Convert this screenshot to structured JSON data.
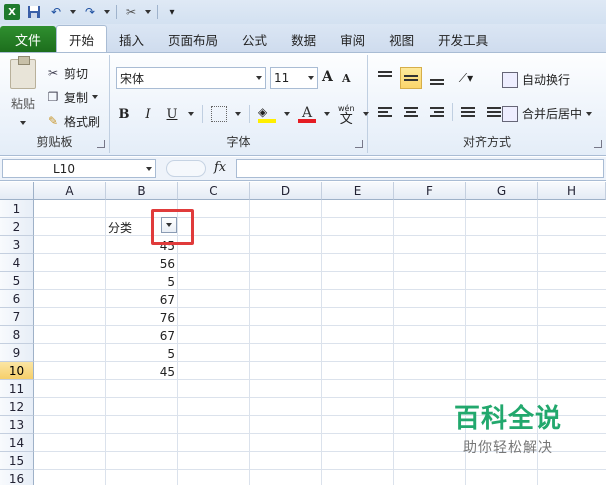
{
  "qat": {
    "icons": [
      "excel-logo-icon",
      "save-icon",
      "undo-icon",
      "redo-icon",
      "customize-icon"
    ]
  },
  "tabs": {
    "file": "文件",
    "items": [
      "开始",
      "插入",
      "页面布局",
      "公式",
      "数据",
      "审阅",
      "视图",
      "开发工具"
    ],
    "active": "开始"
  },
  "clipboard": {
    "paste": "粘贴",
    "cut": "剪切",
    "copy": "复制",
    "format_painter": "格式刷",
    "group_label": "剪贴板"
  },
  "font": {
    "name": "宋体",
    "size": "11",
    "bold": "B",
    "italic": "I",
    "underline": "U",
    "grow": "A",
    "shrink": "A",
    "font_color_glyph": "A",
    "phonetic_top": "wén",
    "phonetic": "文",
    "group_label": "字体",
    "fill_color": "#ffef00",
    "font_color": "#e51c23"
  },
  "alignment": {
    "wrap_text": "自动换行",
    "merge_center": "合并后居中",
    "group_label": "对齐方式"
  },
  "formula_bar": {
    "name_box": "L10",
    "fx": "fx",
    "content": ""
  },
  "grid": {
    "columns": [
      "A",
      "B",
      "C",
      "D",
      "E",
      "F",
      "G",
      "H"
    ],
    "rows": [
      "1",
      "2",
      "3",
      "4",
      "5",
      "6",
      "7",
      "8",
      "9",
      "10",
      "11",
      "12",
      "13",
      "14",
      "15",
      "16"
    ],
    "active_row": "10",
    "header_cell": "分类",
    "values": [
      "45",
      "56",
      "5",
      "67",
      "76",
      "67",
      "5",
      "45"
    ]
  },
  "watermark": {
    "title": "百科全说",
    "subtitle": "助你轻松解决"
  }
}
